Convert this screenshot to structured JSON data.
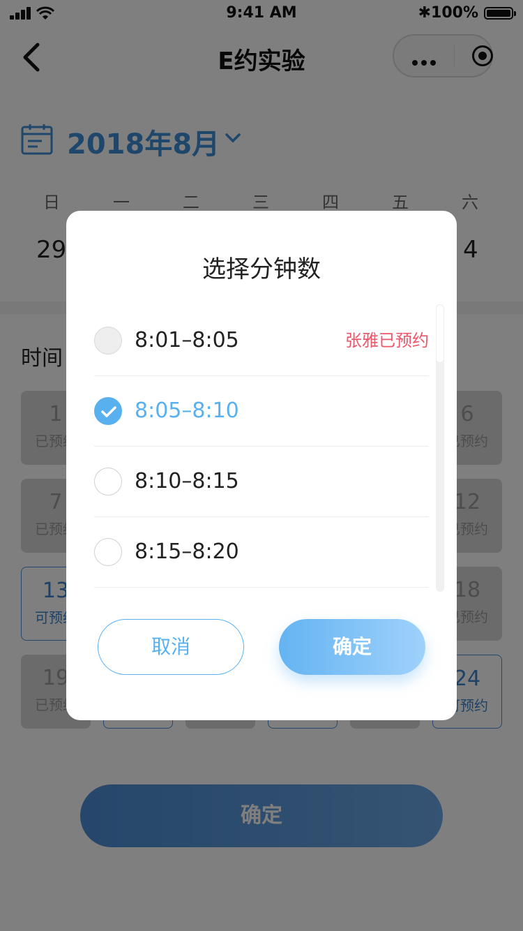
{
  "status": {
    "time": "9:41 AM",
    "battery": "100%"
  },
  "nav": {
    "title": "E约实验"
  },
  "calendar": {
    "month_label": "2018年8月",
    "weekdays": [
      "日",
      "一",
      "二",
      "三",
      "四",
      "五",
      "六"
    ],
    "dates": [
      "29",
      "4"
    ]
  },
  "section": {
    "title": "时间"
  },
  "slots": [
    {
      "num": "1",
      "label": "已预约"
    },
    {
      "num": "6",
      "label": "已预约"
    },
    {
      "num": "7",
      "label": "已预约"
    },
    {
      "num": "12",
      "label": "已预约"
    },
    {
      "num": "13",
      "label": "可预约"
    },
    {
      "num": "18",
      "label": "已预约"
    },
    {
      "num": "19",
      "label": "已预约"
    },
    {
      "num": "24",
      "label": "可预约"
    }
  ],
  "bottom_button": "确定",
  "modal": {
    "title": "选择分钟数",
    "options": [
      {
        "time": "8:01–8:05",
        "note": "张雅已预约",
        "state": "disabled"
      },
      {
        "time": "8:05–8:10",
        "note": "",
        "state": "checked"
      },
      {
        "time": "8:10–8:15",
        "note": "",
        "state": "unchecked"
      },
      {
        "time": "8:15–8:20",
        "note": "",
        "state": "unchecked"
      }
    ],
    "cancel_label": "取消",
    "confirm_label": "确定"
  },
  "colors": {
    "accent": "#58b1ee",
    "primary_blue": "#3e8fd6",
    "booked_note": "#f0566a"
  }
}
